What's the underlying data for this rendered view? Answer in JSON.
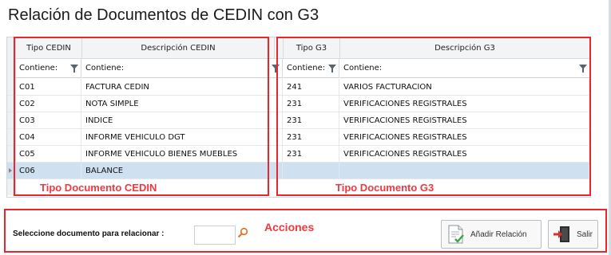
{
  "title": "Relación de Documentos de CEDIN con G3",
  "cedin": {
    "headers": [
      "Tipo CEDIN",
      "Descripción CEDIN"
    ],
    "filters": [
      "Contiene:",
      "Contiene:"
    ],
    "rows": [
      [
        "C01",
        "FACTURA CEDIN"
      ],
      [
        "C02",
        "NOTA SIMPLE"
      ],
      [
        "C03",
        "INDICE"
      ],
      [
        "C04",
        "INFORME VEHICULO DGT"
      ],
      [
        "C05",
        "INFORME VEHICULO BIENES MUEBLES"
      ],
      [
        "C06",
        "BALANCE"
      ]
    ],
    "annotation": "Tipo Documento CEDIN"
  },
  "g3": {
    "headers": [
      "Tipo G3",
      "Descripción G3"
    ],
    "filters": [
      "Contiene:",
      "Contiene:"
    ],
    "rows": [
      [
        "241",
        "VARIOS FACTURACION"
      ],
      [
        "231",
        "VERIFICACIONES REGISTRALES"
      ],
      [
        "231",
        "VERIFICACIONES REGISTRALES"
      ],
      [
        "231",
        "VERIFICACIONES REGISTRALES"
      ],
      [
        "231",
        "VERIFICACIONES REGISTRALES"
      ],
      [
        "",
        ""
      ]
    ],
    "annotation": "Tipo Documento G3"
  },
  "selected_row": 5,
  "actions": {
    "annotation": "Acciones",
    "select_label": "Seleccione documento para relacionar :",
    "document_value": "",
    "add_button": "Añadir Relación",
    "exit_button": "Salir"
  },
  "colors": {
    "annotation_red": "#e8262c",
    "selected_row": "#cfe0f1"
  },
  "icons": [
    "filter-icon",
    "search-icon",
    "add-document-icon",
    "exit-door-icon",
    "row-indicator-icon"
  ]
}
